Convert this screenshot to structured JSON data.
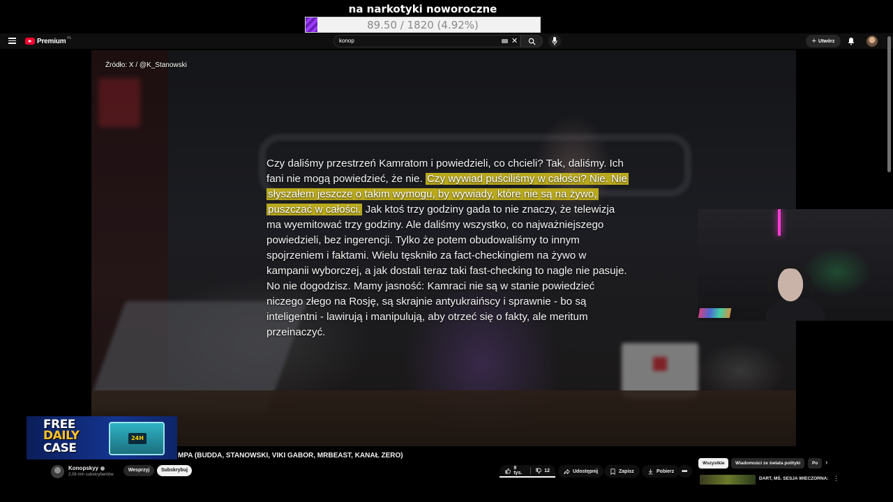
{
  "overlay": {
    "goal_title": "na narkotyki noworoczne",
    "goal_progress_text": "89.50 / 1820 (4.92%)",
    "goal_fraction": 0.0492,
    "goal_fill_color": "#7a2bd6"
  },
  "topbar": {
    "logo_text": "Premium",
    "logo_country": "PL",
    "search_value": "konop",
    "create_label": "Utwórz"
  },
  "video": {
    "source_label": "Źródło: X / @K_Stanowski",
    "quote_part1": "Czy daliśmy przestrzeń Kamratom i powiedzieli, co chcieli? Tak, daliśmy. Ich fani nie mogą powiedzieć, że nie. ",
    "quote_highlight": "Czy wywiad puściliśmy w całości? Nie. Nie słyszałem jeszcze o takim wymogu, by wywiady, które nie są na żywo, puszczać w całości.",
    "quote_part2": " Jak ktoś trzy godziny gada to nie znaczy, że telewizja ma wyemitować trzy godziny. Ale daliśmy wszystko, co najważniejszego powiedzieli, bez ingerencji. Tylko że potem obudowaliśmy to innym spojrzeniem i faktami. Wielu tęskniło za fact-checkingiem na żywo w kampanii wyborczej, a jak dostali teraz taki fast-checking to nagle nie pasuje. No nie dogodzisz. Mamy jasność: Kamraci nie są w stanie powiedzieć niczego złego na Rosję, są skrajnie antyukraińscy i sprawnie - bo są inteligentni - lawirują i manipulują, aby otrzeć się o fakty, ale meritum przeinaczyć.",
    "highlight_color": "#b9a91d"
  },
  "ad": {
    "line1": "FREE",
    "line2": "DAILY",
    "line3": "CASE",
    "box_label": "24H"
  },
  "info": {
    "title_fragment": "MPA (BUDDA, STANOWSKI, VIKI GABOR, MRBEAST, KANAŁ ZERO)",
    "channel_name": "Konopskyy",
    "subscribers": "2,08 mln subskrybentów",
    "support_label": "Wesprzyj",
    "subscribe_label": "Subskrybuj",
    "likes": "9 tys.",
    "dislikes": "12",
    "share_label": "Udostępnij",
    "save_label": "Zapisz",
    "download_label": "Pobierz"
  },
  "sidebar": {
    "chips": [
      "Wszystkie",
      "Wiadomości ze świata polityki",
      "Po"
    ],
    "rec_title": "DART, MŚ. SESJA WIECZORNA:"
  }
}
